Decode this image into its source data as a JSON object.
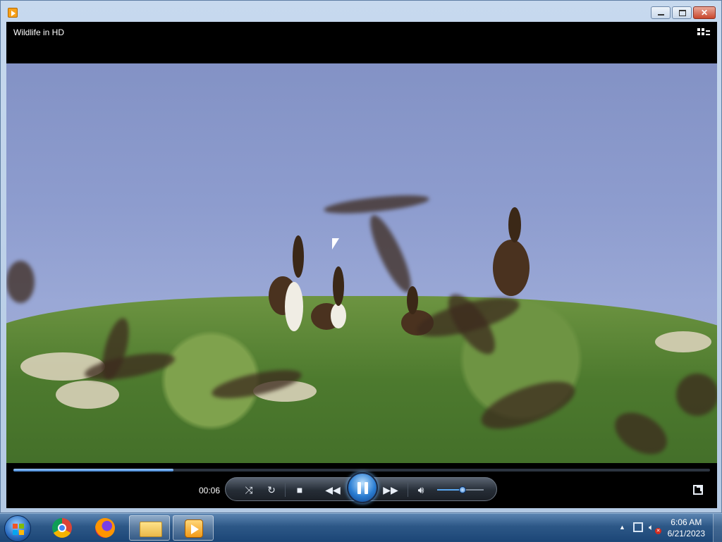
{
  "window": {
    "title": "Wildlife in HD",
    "controls": {
      "minimize": "minimize",
      "maximize": "maximize",
      "close": "close"
    }
  },
  "player": {
    "current_time": "00:06",
    "seek_progress": 0.23,
    "volume_level": 0.55,
    "state": "playing",
    "buttons": [
      "shuffle",
      "repeat",
      "stop",
      "previous",
      "pause",
      "next",
      "mute"
    ]
  },
  "taskbar": {
    "items": [
      "start",
      "chrome",
      "firefox",
      "windows-explorer",
      "windows-media-player"
    ],
    "clock": {
      "time": "6:06 AM",
      "date": "6/21/2023"
    }
  },
  "colors": {
    "accent": "#3f85d6",
    "title_bar": "#b3c9e3",
    "taskbar": "#2d5887"
  }
}
